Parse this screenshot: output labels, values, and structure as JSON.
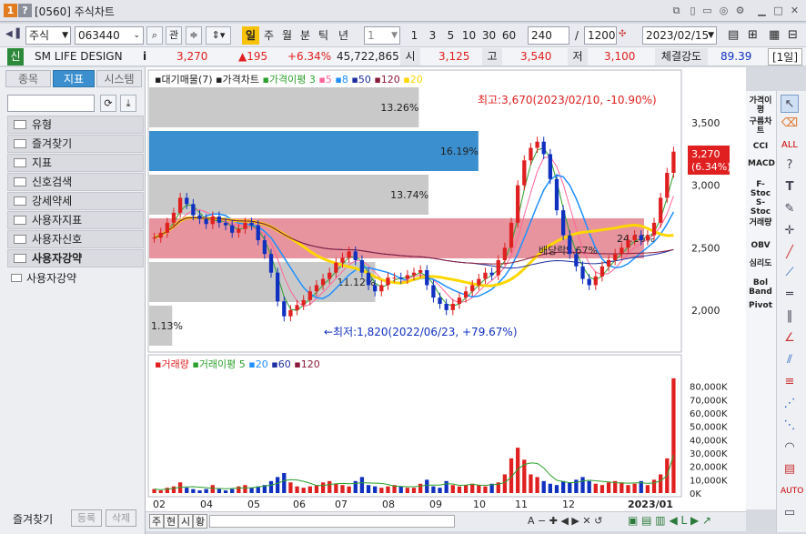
{
  "window": {
    "screen_no": "[0560]",
    "title": "주식차트"
  },
  "toolbar": {
    "market": "주식",
    "code": "063440",
    "lookup": "관",
    "periods": [
      "일",
      "주",
      "월",
      "분",
      "틱",
      "년"
    ],
    "active_period": "일",
    "interval": "1",
    "minutes": [
      "1",
      "3",
      "5",
      "10",
      "30",
      "60"
    ],
    "count": "240",
    "max": "1200",
    "date": "2023/02/15"
  },
  "quote": {
    "prefix": "신",
    "name": "SM LIFE DESIGN",
    "info": "i",
    "price": "3,270",
    "change": "▲195",
    "pct": "+6.34%",
    "volume": "45,722,865",
    "open_label": "시",
    "open": "3,125",
    "high_label": "고",
    "high": "3,540",
    "low_label": "저",
    "low": "3,100",
    "strength_label": "체결강도",
    "strength": "89.39",
    "unit": "[1일]"
  },
  "sidebar": {
    "tabs": [
      "종목",
      "지표",
      "시스템"
    ],
    "active_tab": "지표",
    "items": [
      "유형",
      "즐겨찾기",
      "지표",
      "신호검색",
      "강세약세",
      "사용자지표",
      "사용자신호",
      "사용자강약"
    ],
    "subitem": "사용자강약",
    "bottom": [
      "즐겨찾기",
      "등록",
      "삭제"
    ]
  },
  "price_legend": {
    "a": "대기매물(7)",
    "b": "가격차트",
    "c": "가격이평",
    "n3": "3",
    "n5": "5",
    "n8": "8",
    "n50": "50",
    "n120": "120",
    "n20": "20"
  },
  "volume_legend": {
    "a": "거래량",
    "b": "거래이평",
    "n5": "5",
    "n20": "20",
    "n60": "60",
    "n120": "120"
  },
  "annotations": {
    "high": "최고:3,670(2023/02/10, -10.90%)",
    "low": "←최저:1,820(2022/06/23, +79.67%)",
    "dividend": "배당락",
    "current_price": "3,270",
    "current_pct": "(6.34%)"
  },
  "price_axis": [
    "3,500",
    "3,000",
    "2,500",
    "2,000"
  ],
  "volume_axis": [
    "80,000K",
    "70,000K",
    "60,000K",
    "50,000K",
    "40,000K",
    "30,000K",
    "20,000K",
    "10,000K",
    "0K"
  ],
  "months": [
    "02",
    "04",
    "05",
    "06",
    "07",
    "08",
    "09",
    "10",
    "11",
    "12",
    "2023/01"
  ],
  "right_tools": [
    "가격이평",
    "구름차트",
    "CCI",
    "MACD",
    "F-Stoc",
    "S-Stoc",
    "거래량",
    "OBV",
    "심리도",
    "Bol Band",
    "Pivot"
  ],
  "bottom_controls": [
    "주",
    "현",
    "시",
    "황"
  ],
  "colors": {
    "accent_blue": "#3b8fcf",
    "up": "#e02020",
    "down": "#1030c0",
    "ma3": "#2ca02c",
    "ma5": "#ff6699",
    "ma8": "#1e90ff",
    "ma50": "#1f2fa0",
    "ma120": "#8b1a3a",
    "ma20": "#ffd700"
  },
  "chart_data": {
    "type": "candlestick",
    "volume_profile": [
      {
        "value": 1.13,
        "label": "1.13%"
      },
      {
        "value": 11.12,
        "label": "11.12%"
      },
      {
        "value": 24.16,
        "label": "24.16%"
      },
      {
        "value": 13.74,
        "label": "13.74%"
      },
      {
        "value": 16.19,
        "label": "16.19%"
      },
      {
        "value": 13.26,
        "label": "13.26%"
      }
    ],
    "dividend_label": "5.67%",
    "price_ylim": [
      1700,
      3800
    ],
    "close": [
      2580,
      2620,
      2700,
      2780,
      2900,
      2850,
      2760,
      2730,
      2690,
      2750,
      2700,
      2680,
      2620,
      2650,
      2700,
      2680,
      2560,
      2450,
      2300,
      2070,
      1950,
      2000,
      2040,
      2080,
      2150,
      2200,
      2250,
      2300,
      2380,
      2420,
      2470,
      2400,
      2300,
      2200,
      2150,
      2200,
      2260,
      2260,
      2250,
      2280,
      2300,
      2320,
      2200,
      2100,
      2050,
      2000,
      2050,
      2100,
      2150,
      2200,
      2250,
      2300,
      2280,
      2400,
      2500,
      2700,
      3000,
      3200,
      3300,
      3350,
      3250,
      3050,
      2800,
      2600,
      2450,
      2350,
      2250,
      2200,
      2270,
      2350,
      2400,
      2450,
      2500,
      2560,
      2600,
      2560,
      2600,
      2700,
      2900,
      3100,
      3270
    ],
    "volume": [
      3,
      2,
      4,
      5,
      8,
      4,
      3,
      2,
      3,
      6,
      3,
      2,
      3,
      5,
      6,
      4,
      5,
      6,
      9,
      12,
      15,
      8,
      5,
      4,
      5,
      6,
      8,
      9,
      7,
      6,
      5,
      9,
      12,
      6,
      5,
      4,
      5,
      6,
      5,
      4,
      4,
      7,
      10,
      5,
      4,
      9,
      6,
      5,
      6,
      7,
      6,
      5,
      7,
      8,
      14,
      26,
      34,
      25,
      14,
      12,
      9,
      7,
      6,
      9,
      8,
      10,
      12,
      9,
      7,
      6,
      8,
      9,
      8,
      6,
      7,
      9,
      6,
      10,
      14,
      26,
      86
    ]
  }
}
